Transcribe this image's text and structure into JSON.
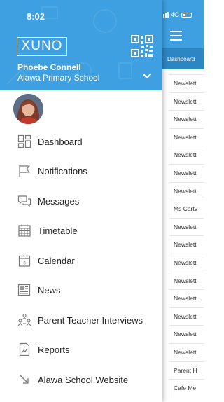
{
  "status_bar": {
    "time": "8:02",
    "network": "4G"
  },
  "drawer": {
    "logo_text": "XUNO",
    "user_name": "Phoebe Connell",
    "school_name": "Alawa Primary School",
    "menu": [
      {
        "label": "Dashboard",
        "icon": "dashboard-icon"
      },
      {
        "label": "Notifications",
        "icon": "flag-icon"
      },
      {
        "label": "Messages",
        "icon": "messages-icon"
      },
      {
        "label": "Timetable",
        "icon": "timetable-icon"
      },
      {
        "label": "Calendar",
        "icon": "calendar-icon"
      },
      {
        "label": "News",
        "icon": "news-icon"
      },
      {
        "label": "Parent Teacher Interviews",
        "icon": "interviews-icon"
      },
      {
        "label": "Reports",
        "icon": "reports-icon"
      },
      {
        "label": "Alawa School Website",
        "icon": "external-link-icon"
      }
    ]
  },
  "background_app": {
    "tab_label": "Dashboard",
    "list_items": [
      "Newslett",
      "Newslett",
      "Newslett",
      "Newslett",
      "Newslett",
      "Newslett",
      "Newslett",
      "Ms Cartv",
      "Newslett",
      "Newslett",
      "Newslett",
      "Newslett",
      "Newslett",
      "Newslett",
      "Newslett",
      "Newslett",
      "Parent H",
      "Cafe Me"
    ]
  },
  "colors": {
    "accent": "#3ea0e0",
    "accent_dark": "#2d86c4"
  }
}
